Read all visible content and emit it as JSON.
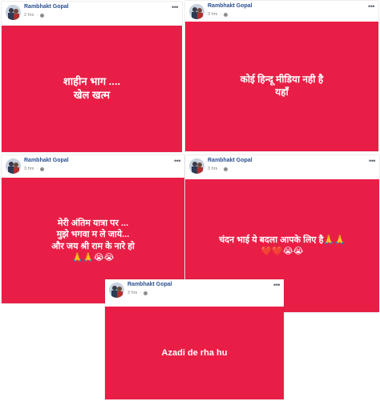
{
  "posts": [
    {
      "author": "Rambhakt Gopal",
      "time": "2 hrs",
      "text": "शाहीन भाग ....\nखेल खत्म"
    },
    {
      "author": "Rambhakt Gopal",
      "time": "3 hrs",
      "text": "कोई हिन्दू मीडिया नही है\nयहाँ"
    },
    {
      "author": "Rambhakt Gopal",
      "time": "3 hrs",
      "text": "मेरी अंतिम यात्रा पर ...\nमुझे भगवा म ले जाये...\nऔर जय श्री राम के नारे हो\n🙏🙏😭😭"
    },
    {
      "author": "Rambhakt Gopal",
      "time": "3 hrs",
      "text": "चंदन भाई ये बदला आपके लिए है🙏🙏\n❤️❤️😭😭"
    },
    {
      "author": "Rambhakt Gopal",
      "time": "3 hrs",
      "text": "Azadi de rha hu"
    }
  ],
  "colors": {
    "card_background": "#e91e46",
    "author_link": "#2a4f8f"
  }
}
